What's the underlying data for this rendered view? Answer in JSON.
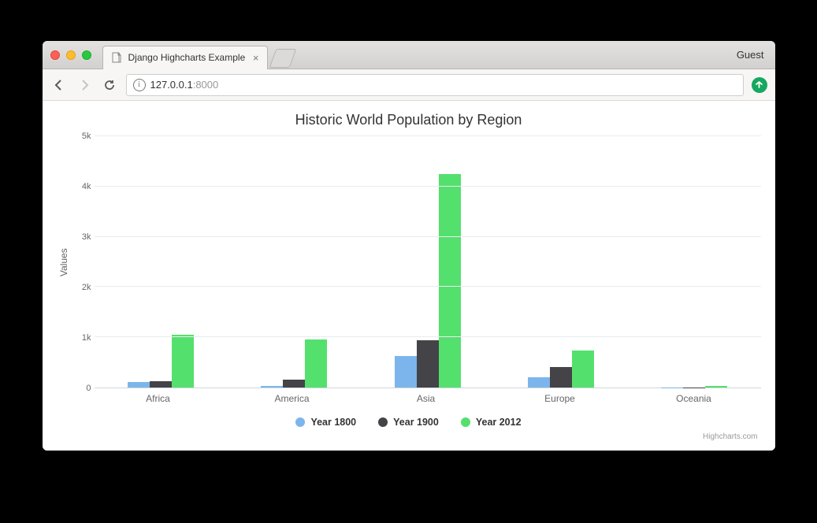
{
  "browser": {
    "tab_title": "Django Highcharts Example",
    "guest_label": "Guest",
    "url_host": "127.0.0.1",
    "url_port": ":8000"
  },
  "chart_data": {
    "type": "bar",
    "title": "Historic World Population by Region",
    "ylabel": "Values",
    "xlabel": "",
    "ylim": [
      0,
      5000
    ],
    "yticks": [
      "0",
      "1k",
      "2k",
      "3k",
      "4k",
      "5k"
    ],
    "categories": [
      "Africa",
      "America",
      "Asia",
      "Europe",
      "Oceania"
    ],
    "series": [
      {
        "name": "Year 1800",
        "color": "#7cb5ec",
        "values": [
          107,
          31,
          635,
          203,
          2
        ]
      },
      {
        "name": "Year 1900",
        "color": "#434348",
        "values": [
          133,
          156,
          947,
          408,
          6
        ]
      },
      {
        "name": "Year 2012",
        "color": "#54e06d",
        "values": [
          1052,
          954,
          4250,
          740,
          38
        ]
      }
    ],
    "credits": "Highcharts.com"
  }
}
